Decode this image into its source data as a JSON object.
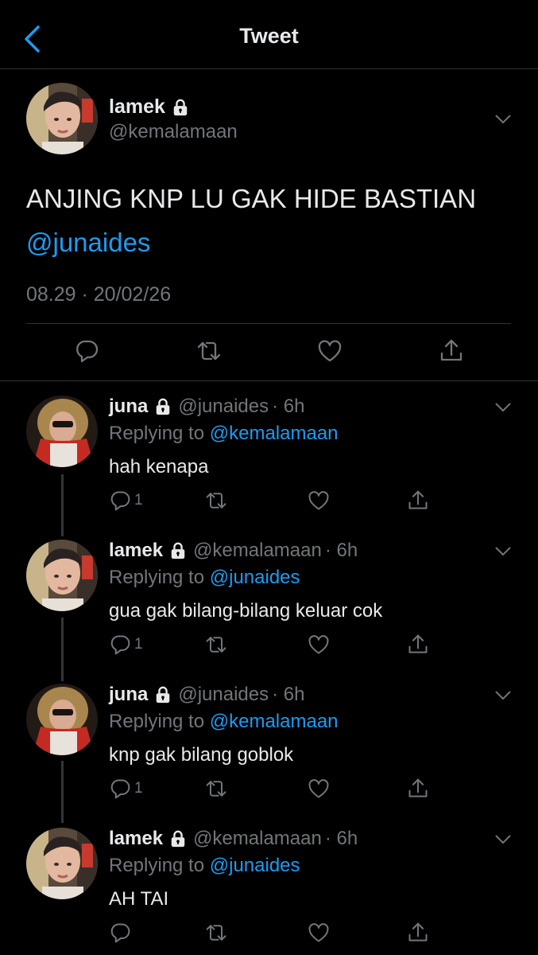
{
  "header": {
    "title": "Tweet",
    "back_icon": "chevron-left-icon"
  },
  "colors": {
    "accent": "#1d9bf0",
    "muted": "#71767b",
    "background": "#000000",
    "text": "#e7e9ea"
  },
  "main_tweet": {
    "name": "lamek",
    "handle": "@kemalamaan",
    "text": "ANJING KNP LU GAK HIDE BASTIAN",
    "mention": "@junaides",
    "timestamp": "08.29 · 20/02/26",
    "actions": [
      "reply-icon",
      "retweet-icon",
      "like-icon",
      "share-icon"
    ]
  },
  "replies": [
    {
      "name": "juna",
      "handle": "@junaides",
      "time": "· 6h",
      "replying_prefix": "Replying to ",
      "replying_to": "@kemalamaan",
      "text": "hah kenapa",
      "reply_count": "1"
    },
    {
      "name": "lamek",
      "handle": "@kemalamaan",
      "time": "· 6h",
      "replying_prefix": "Replying to ",
      "replying_to": "@junaides",
      "text": "gua gak bilang-bilang keluar cok",
      "reply_count": "1"
    },
    {
      "name": "juna",
      "handle": "@junaides",
      "time": "· 6h",
      "replying_prefix": "Replying to ",
      "replying_to": "@kemalamaan",
      "text": "knp gak bilang goblok",
      "reply_count": "1"
    },
    {
      "name": "lamek",
      "handle": "@kemalamaan",
      "time": "· 6h",
      "replying_prefix": "Replying to ",
      "replying_to": "@junaides",
      "text": "AH TAI",
      "reply_count": ""
    }
  ]
}
